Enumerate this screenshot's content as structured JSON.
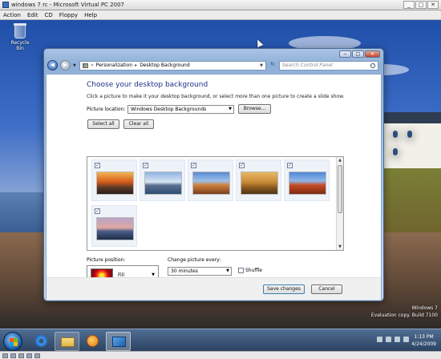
{
  "host": {
    "title": "windows 7 rc - Microsoft Virtual PC 2007",
    "menu": [
      "Action",
      "Edit",
      "CD",
      "Floppy",
      "Help"
    ],
    "controls": [
      "_",
      "□",
      "✕"
    ]
  },
  "desktop": {
    "recycle_bin_label": "Recycle Bin",
    "watermark": {
      "line1": "Windows 7",
      "line2": "Evaluation copy. Build 7100"
    }
  },
  "window": {
    "caption_controls": [
      "−",
      "□",
      "✕"
    ],
    "breadcrumb": [
      "Personalization",
      "Desktop Background"
    ],
    "search_placeholder": "Search Control Panel",
    "heading": "Choose your desktop background",
    "description": "Click a picture to make it your desktop background, or select more than one picture to create a slide show.",
    "picture_location_label": "Picture location:",
    "picture_location_value": "Windows Desktop Backgrounds",
    "browse_label": "Browse...",
    "select_all_label": "Select all",
    "clear_all_label": "Clear all",
    "pictures": [
      {
        "checked": true,
        "theme": "sunset-dock"
      },
      {
        "checked": true,
        "theme": "lighthouse"
      },
      {
        "checked": true,
        "theme": "red-rock"
      },
      {
        "checked": true,
        "theme": "hay-bale"
      },
      {
        "checked": true,
        "theme": "arch"
      },
      {
        "checked": true,
        "theme": "dusk-lake"
      }
    ],
    "picture_position_label": "Picture position:",
    "picture_position_value": "Fill",
    "change_every_label": "Change picture every:",
    "change_every_value": "30 minutes",
    "shuffle_label": "Shuffle",
    "shuffle_checked": false,
    "save_label": "Save changes",
    "cancel_label": "Cancel"
  },
  "taskbar": {
    "time": "1:13 PM",
    "date": "4/24/2009"
  }
}
